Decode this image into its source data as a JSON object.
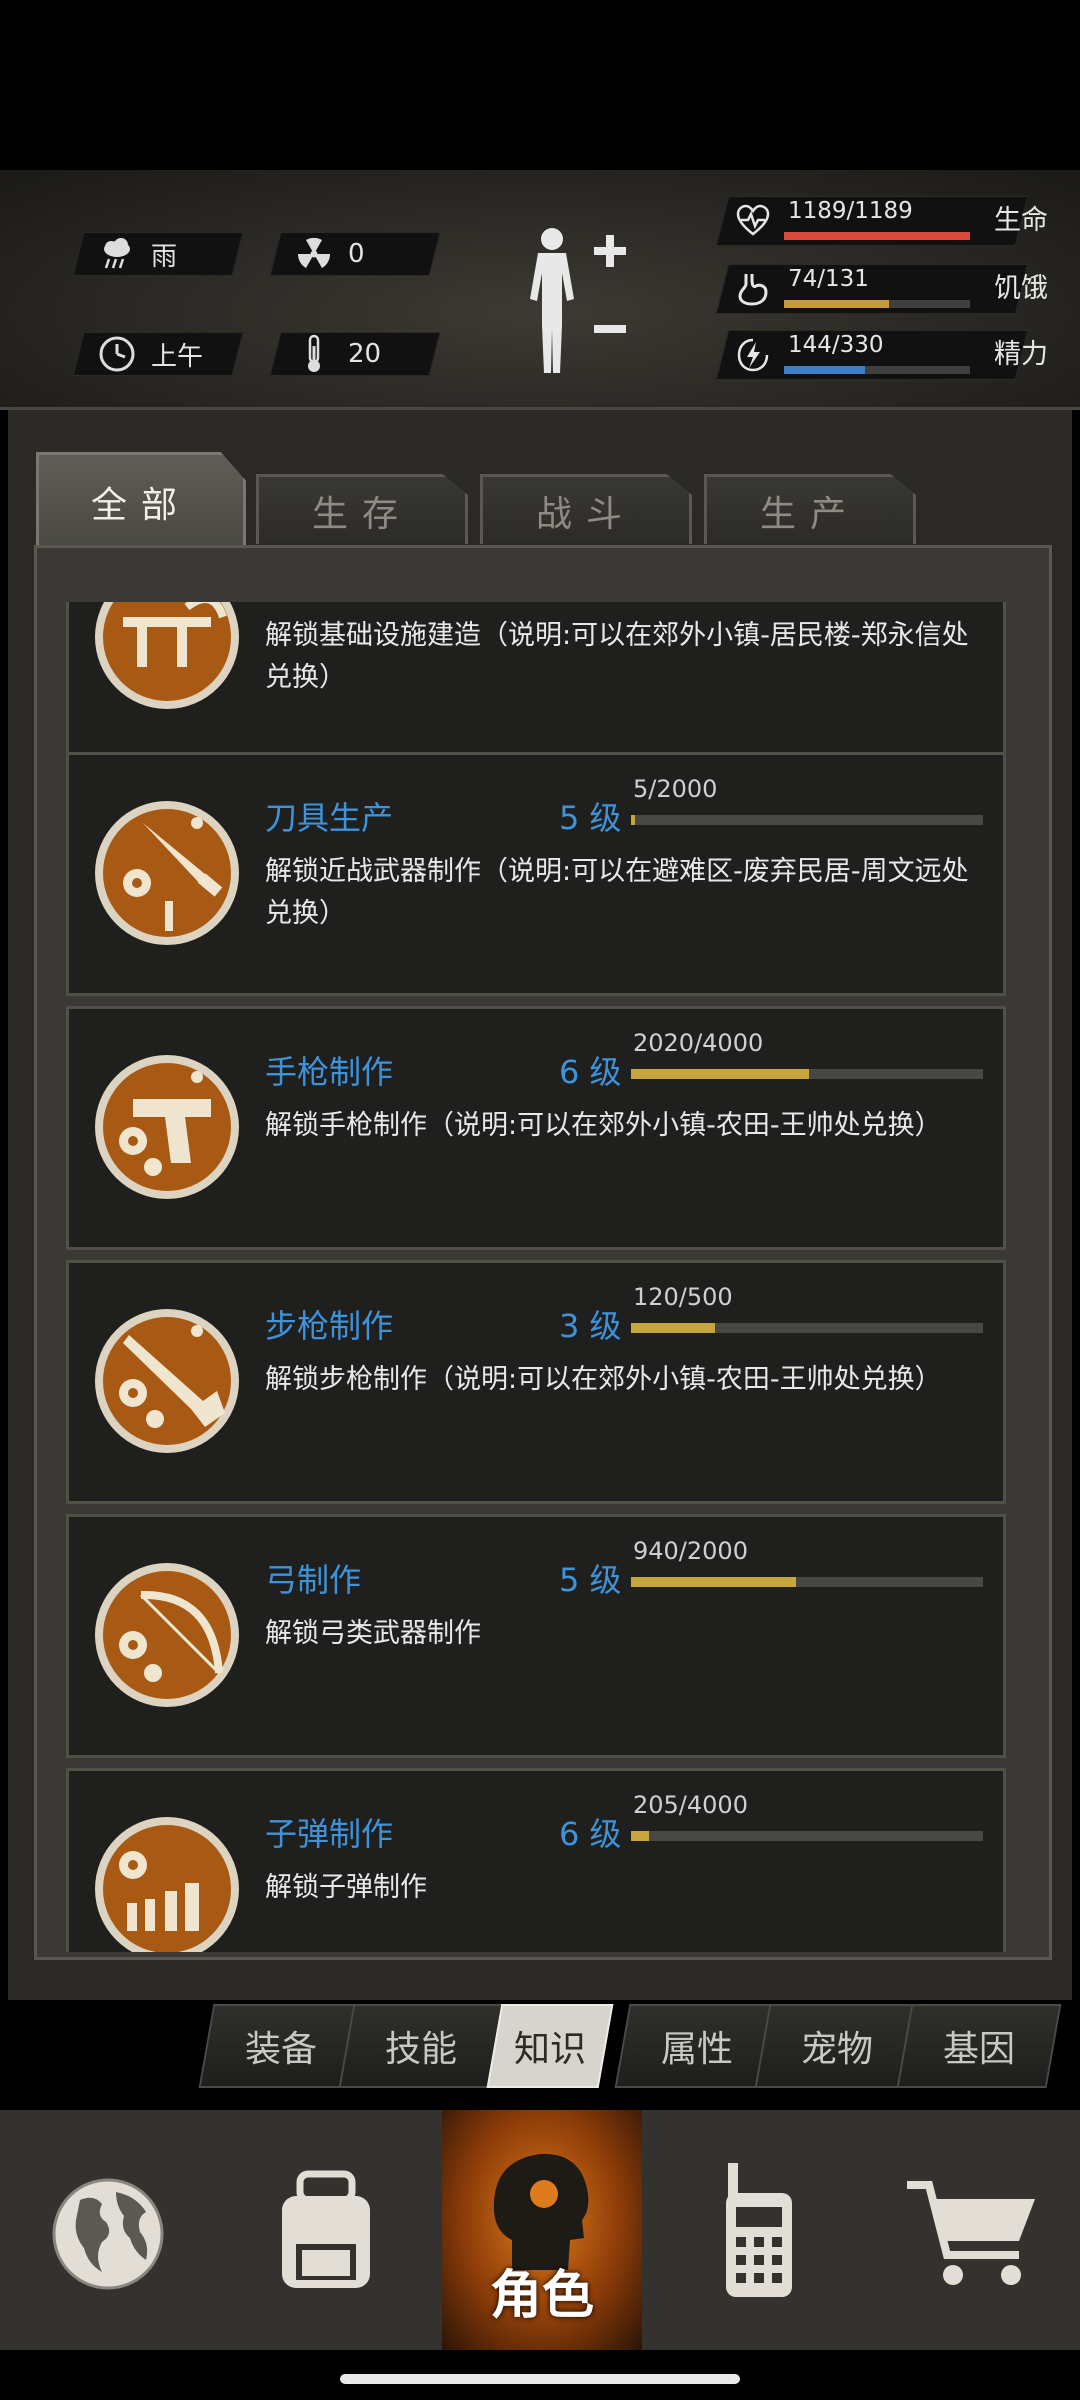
{
  "header": {
    "weather": {
      "icon": "rain-cloud-icon",
      "label": "雨"
    },
    "radiation": {
      "icon": "radiation-icon",
      "value": "0"
    },
    "time": {
      "icon": "clock-icon",
      "label": "上午"
    },
    "temperature": {
      "icon": "thermometer-icon",
      "value": "20"
    },
    "stats": [
      {
        "name": "生命",
        "icon": "heart-pulse-icon",
        "value": "1189/1189",
        "current": 1189,
        "max": 1189,
        "color": "#d9483b"
      },
      {
        "name": "饥饿",
        "icon": "stomach-icon",
        "value": "74/131",
        "current": 74,
        "max": 131,
        "color": "#c79a3b"
      },
      {
        "name": "精力",
        "icon": "energy-bolt-icon",
        "value": "144/330",
        "current": 144,
        "max": 330,
        "color": "#3e7fc4"
      }
    ]
  },
  "tabs": [
    {
      "label": "全部",
      "active": true
    },
    {
      "label": "生存",
      "active": false
    },
    {
      "label": "战斗",
      "active": false
    },
    {
      "label": "生产",
      "active": false
    }
  ],
  "skills": [
    {
      "name": "",
      "level": "",
      "xp": "",
      "progress": 0,
      "icon": "building-construction-icon",
      "desc": "解锁基础设施建造（说明:可以在郊外小镇-居民楼-郑永信处兑换）"
    },
    {
      "name": "刀具生产",
      "level": "5 级",
      "xp": "5/2000",
      "progress": 0.0025,
      "icon": "knife-crafting-icon",
      "desc": "解锁近战武器制作（说明:可以在避难区-废弃民居-周文远处兑换）"
    },
    {
      "name": "手枪制作",
      "level": "6 级",
      "xp": "2020/4000",
      "progress": 0.505,
      "icon": "pistol-crafting-icon",
      "desc": "解锁手枪制作（说明:可以在郊外小镇-农田-王帅处兑换）"
    },
    {
      "name": "步枪制作",
      "level": "3 级",
      "xp": "120/500",
      "progress": 0.24,
      "icon": "rifle-crafting-icon",
      "desc": "解锁步枪制作（说明:可以在郊外小镇-农田-王帅处兑换）"
    },
    {
      "name": "弓制作",
      "level": "5 级",
      "xp": "940/2000",
      "progress": 0.47,
      "icon": "bow-crafting-icon",
      "desc": "解锁弓类武器制作"
    },
    {
      "name": "子弹制作",
      "level": "6 级",
      "xp": "205/4000",
      "progress": 0.05125,
      "icon": "bullet-crafting-icon",
      "desc": "解锁子弹制作"
    }
  ],
  "subtabs": [
    {
      "label": "装备",
      "active": false
    },
    {
      "label": "技能",
      "active": false
    },
    {
      "label": "知识",
      "active": true
    },
    {
      "label": "属性",
      "active": false
    },
    {
      "label": "宠物",
      "active": false
    },
    {
      "label": "基因",
      "active": false
    }
  ],
  "nav": [
    {
      "icon": "globe-icon",
      "label": "",
      "active": false
    },
    {
      "icon": "backpack-icon",
      "label": "",
      "active": false
    },
    {
      "icon": "character-head-icon",
      "label": "角色",
      "active": true
    },
    {
      "icon": "walkie-talkie-icon",
      "label": "",
      "active": false
    },
    {
      "icon": "shopping-cart-icon",
      "label": "",
      "active": false
    }
  ]
}
